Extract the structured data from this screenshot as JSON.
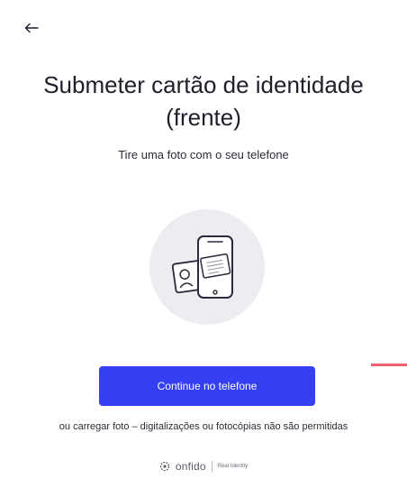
{
  "header": {
    "back_icon": "arrow-left-icon",
    "back_glyph": "←"
  },
  "main": {
    "title": "Submeter cartão de identidade (frente)",
    "subtitle": "Tire uma foto com o seu telefone",
    "illustration_icon": "phone-with-id-card-icon",
    "primary_button_label": "Continue no telefone",
    "upload_link_text": "ou carregar foto – digitalizações ou fotocópias não são permitidas"
  },
  "footer": {
    "logo_icon": "onfido-logo-icon",
    "brand_name": "onfido",
    "tagline": "Real Identity"
  },
  "colors": {
    "accent": "#353ff4",
    "illustration_bg": "#ebedf1",
    "red_marker": "#ee5f6f"
  }
}
